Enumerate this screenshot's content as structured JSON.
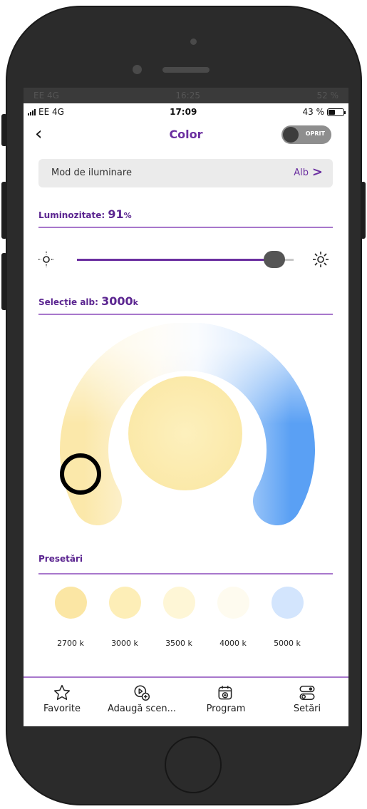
{
  "ghost_status": {
    "carrier": "EE 4G",
    "time": "16:25",
    "battery": "52 %"
  },
  "status": {
    "carrier": "EE 4G",
    "time": "17:09",
    "battery": "43 %",
    "battery_level": 0.43
  },
  "header": {
    "back_icon": "chevron-left-icon",
    "title": "Color",
    "power_toggle_label": "OPRIT",
    "power_on": false
  },
  "mode": {
    "label": "Mod de iluminare",
    "value": "Alb",
    "chevron": ">"
  },
  "brightness": {
    "label": "Luminozitate:",
    "value": "91",
    "unit": "%",
    "level": 0.91
  },
  "white": {
    "label": "Selecție alb:",
    "value": "3000",
    "unit": "k"
  },
  "presets": {
    "title": "Presetări",
    "items": [
      {
        "label": "2700 k",
        "color": "#fbe6a4"
      },
      {
        "label": "3000 k",
        "color": "#fdeeb7"
      },
      {
        "label": "3500 k",
        "color": "#fef6d6"
      },
      {
        "label": "4000 k",
        "color": "#fefbef"
      },
      {
        "label": "5000 k",
        "color": "#d3e5fd"
      }
    ]
  },
  "tabs": [
    {
      "label": "Favorite",
      "icon": "star-icon"
    },
    {
      "label": "Adaugă scen...",
      "icon": "add-scene-icon"
    },
    {
      "label": "Program",
      "icon": "calendar-add-icon"
    },
    {
      "label": "Setări",
      "icon": "settings-toggles-icon"
    }
  ],
  "colors": {
    "accent": "#6b2fa0",
    "warm": "#fbe8aa",
    "cool": "#5aa0f4",
    "selected_color": "#fcefb7"
  }
}
